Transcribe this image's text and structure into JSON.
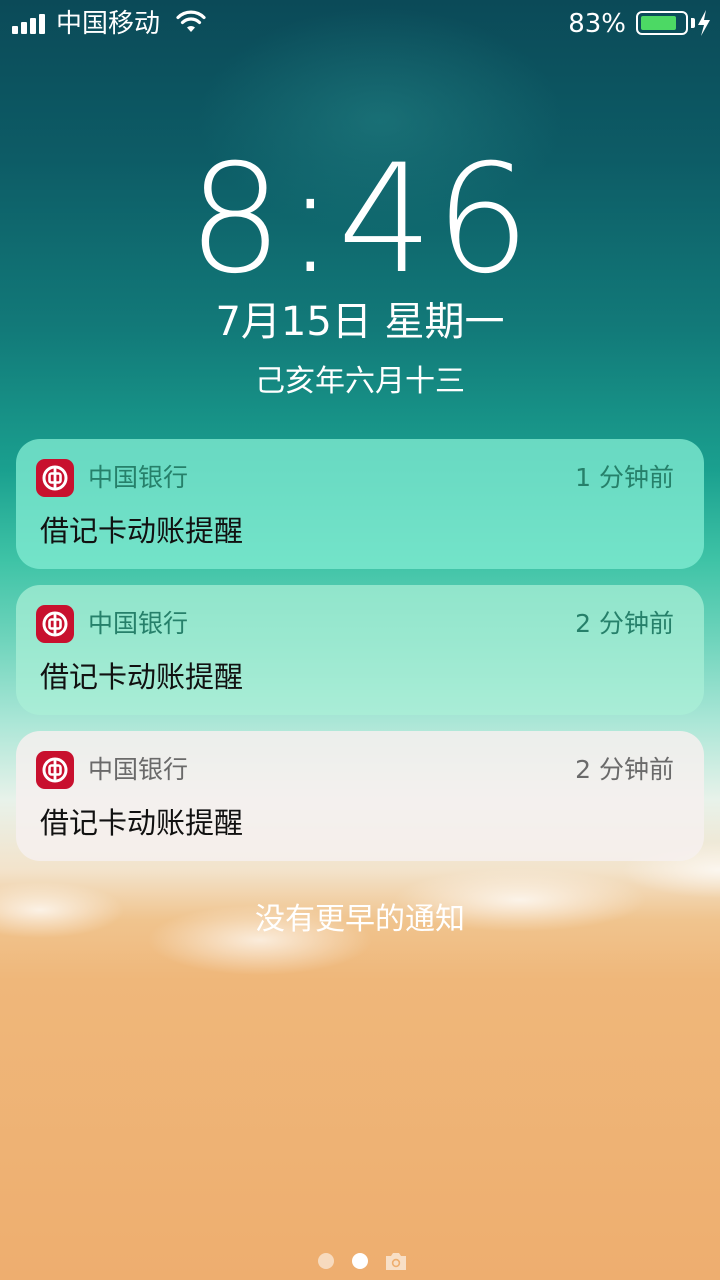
{
  "status_bar": {
    "carrier": "中国移动",
    "battery_percent": "83%",
    "battery_level": 0.83,
    "signal_bars": 4,
    "charging": true
  },
  "lock_screen": {
    "time": "8:46",
    "date": "7月15日 星期一",
    "lunar_date": "己亥年六月十三"
  },
  "notifications": [
    {
      "app": "中国银行",
      "time": "1 分钟前",
      "message": "借记卡动账提醒",
      "icon": "bank-of-china-icon"
    },
    {
      "app": "中国银行",
      "time": "2 分钟前",
      "message": "借记卡动账提醒",
      "icon": "bank-of-china-icon"
    },
    {
      "app": "中国银行",
      "time": "2 分钟前",
      "message": "借记卡动账提醒",
      "icon": "bank-of-china-icon"
    }
  ],
  "footer": {
    "no_earlier": "没有更早的通知"
  },
  "page_indicator": {
    "pages": 2,
    "active": 2,
    "extra": "camera-icon"
  },
  "colors": {
    "battery_fill": "#4cd964",
    "app_icon": "#c8102e"
  }
}
